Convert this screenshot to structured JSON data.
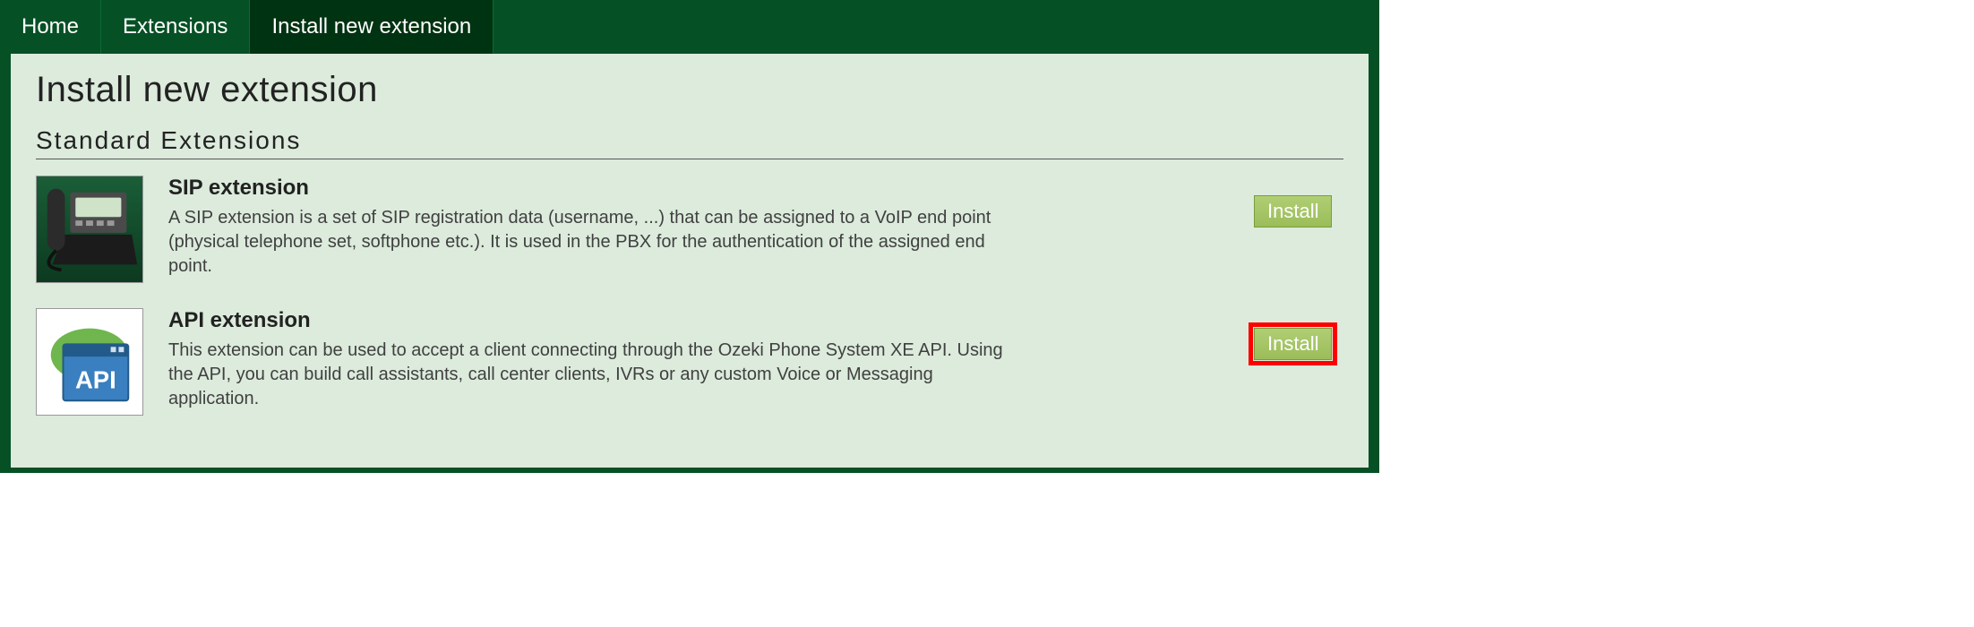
{
  "nav": {
    "home": "Home",
    "extensions": "Extensions",
    "install_new": "Install new extension"
  },
  "page": {
    "title": "Install new extension",
    "section": "Standard Extensions"
  },
  "extensions": [
    {
      "title": "SIP extension",
      "desc": "A SIP extension is a set of SIP registration data (username, ...) that can be assigned to a VoIP end point (physical telephone set, softphone etc.). It is used in the PBX for the authentication of the assigned end point.",
      "install_label": "Install",
      "highlighted": false
    },
    {
      "title": "API extension",
      "desc": "This extension can be used to accept a client connecting through the Ozeki Phone System XE API. Using the API, you can build call assistants, call center clients, IVRs or any custom Voice or Messaging application.",
      "install_label": "Install",
      "highlighted": true
    }
  ]
}
